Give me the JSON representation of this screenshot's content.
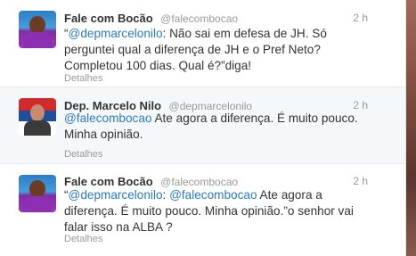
{
  "tweets": [
    {
      "name": "Fale com Bocão",
      "handle": "@falecombocao",
      "time": "2 h",
      "text_parts": [
        "“",
        "@depmarcelonilo",
        ":  Não sai em defesa de JH.  Só perguntei qual a diferença de JH e o Pref Neto? Completou 100 dias. Qual é?”diga!"
      ],
      "details": "Detalhes"
    },
    {
      "name": "Dep. Marcelo Nilo",
      "handle": "@depmarcelonilo",
      "time": "2 h",
      "text_parts": [
        "@falecombocao",
        " Ate agora a diferença.  É muito pouco. Minha opinião."
      ],
      "details": "Detalhes"
    },
    {
      "name": "Fale com Bocão",
      "handle": "@falecombocao",
      "time": "2 h",
      "text_parts": [
        "“",
        "@depmarcelonilo",
        ": ",
        "@falecombocao",
        " Ate agora a diferença. É muito pouco. Minha opinião.”o senhor vai falar isso na ALBA ?"
      ],
      "details": "Detalhes"
    }
  ]
}
